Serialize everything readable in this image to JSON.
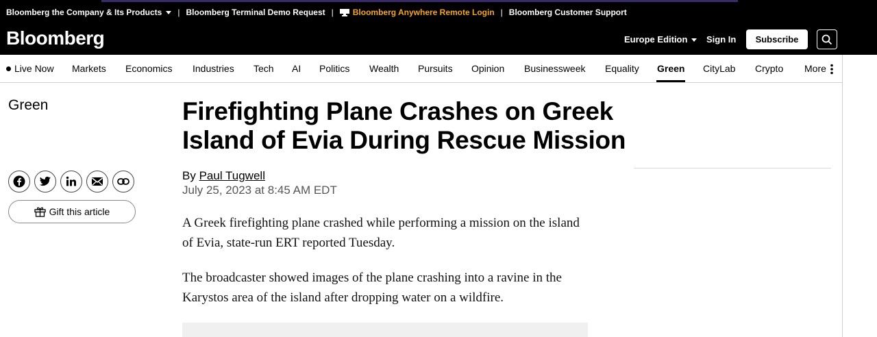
{
  "utility_bar": {
    "company_products": "Bloomberg the Company & Its Products",
    "terminal_demo": "Bloomberg Terminal Demo Request",
    "anywhere_login": "Bloomberg Anywhere Remote Login",
    "customer_support": "Bloomberg Customer Support",
    "separator": "|"
  },
  "header": {
    "logo": "Bloomberg",
    "edition": "Europe Edition",
    "sign_in": "Sign In",
    "subscribe": "Subscribe"
  },
  "nav": {
    "items": [
      "Live Now",
      "Markets",
      "Economics",
      "Industries",
      "Tech",
      "AI",
      "Politics",
      "Wealth",
      "Pursuits",
      "Opinion",
      "Businessweek",
      "Equality",
      "Green",
      "CityLab",
      "Crypto",
      "More"
    ],
    "active": "Green"
  },
  "article": {
    "section": "Green",
    "headline": "Firefighting Plane Crashes on Greek Island of Evia During Rescue Mission",
    "by_prefix": "By",
    "author": "Paul Tugwell",
    "date": "July 25, 2023 at 8:45 AM EDT",
    "paragraphs": [
      "A Greek firefighting plane crashed while performing a mission on the island of Evia, state-run ERT reported Tuesday.",
      "The broadcaster showed images of the plane crashing into a ravine in the Karystos area of the island after dropping water on a wildfire."
    ]
  },
  "share": {
    "gift_label": "Gift this article",
    "buttons": [
      "facebook-icon",
      "twitter-icon",
      "linkedin-icon",
      "email-icon",
      "link-icon"
    ]
  },
  "colors": {
    "bar_bg": "#000000",
    "accent_orange": "#f5a623",
    "text": "#000000",
    "muted": "#555555"
  }
}
